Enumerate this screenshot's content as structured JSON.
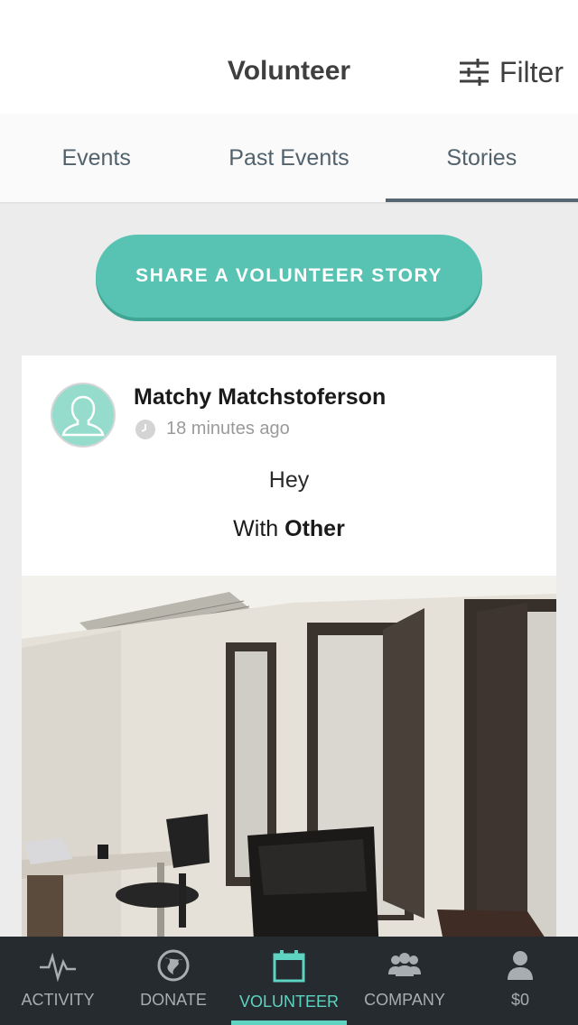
{
  "header": {
    "title": "Volunteer",
    "filter_label": "Filter",
    "filter_icon": "sliders-icon"
  },
  "tabs": [
    {
      "label": "Events",
      "active": false
    },
    {
      "label": "Past Events",
      "active": false
    },
    {
      "label": "Stories",
      "active": true
    }
  ],
  "share_button": {
    "label": "SHARE A VOLUNTEER STORY"
  },
  "story": {
    "author": "Matchy Matchstoferson",
    "time": "18 minutes ago",
    "text": "Hey",
    "with_prefix": "With",
    "with_value": "Other",
    "avatar_icon": "user-icon",
    "time_icon": "clock-icon"
  },
  "tabbar": [
    {
      "label": "ACTIVITY",
      "icon": "activity-icon",
      "active": false
    },
    {
      "label": "DONATE",
      "icon": "globe-icon",
      "active": false
    },
    {
      "label": "VOLUNTEER",
      "icon": "calendar-icon",
      "active": true
    },
    {
      "label": "COMPANY",
      "icon": "group-icon",
      "active": false
    },
    {
      "label": "$0",
      "icon": "person-icon",
      "active": false
    }
  ],
  "colors": {
    "accent": "#58c3b2",
    "tabbar_bg": "#262b2f",
    "tabbar_active": "#5fd3c1"
  }
}
